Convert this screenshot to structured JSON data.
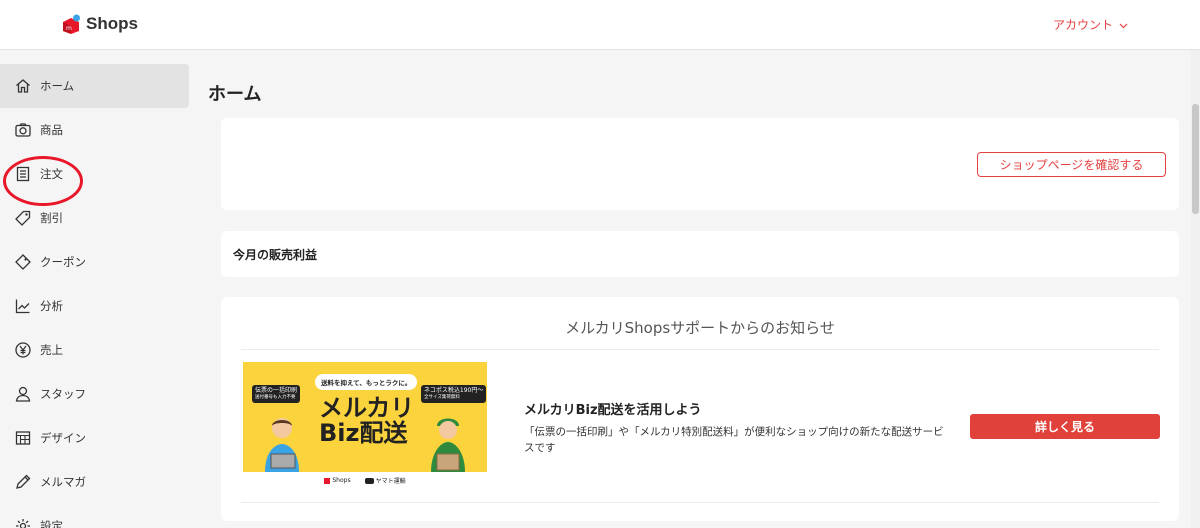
{
  "header": {
    "logo_text": "Shops",
    "account_label": "アカウント"
  },
  "sidebar": {
    "items": [
      {
        "label": "ホーム",
        "icon": "home-icon",
        "active": true
      },
      {
        "label": "商品",
        "icon": "camera-icon"
      },
      {
        "label": "注文",
        "icon": "list-icon"
      },
      {
        "label": "割引",
        "icon": "tag-icon"
      },
      {
        "label": "クーポン",
        "icon": "coupon-icon"
      },
      {
        "label": "分析",
        "icon": "chart-icon"
      },
      {
        "label": "売上",
        "icon": "yen-icon"
      },
      {
        "label": "スタッフ",
        "icon": "user-icon"
      },
      {
        "label": "デザイン",
        "icon": "design-icon"
      },
      {
        "label": "メルマガ",
        "icon": "pen-icon"
      },
      {
        "label": "設定",
        "icon": "gear-icon"
      }
    ]
  },
  "main": {
    "title": "ホーム",
    "shop_page_button": "ショップページを確認する",
    "monthly_profit_label": "今月の販売利益",
    "notice": {
      "title": "メルカリShopsサポートからのお知らせ",
      "headline": "メルカリBiz配送を活用しよう",
      "description": "「伝票の一括印刷」や「メルカリ特別配送料」が便利なショップ向けの新たな配送サービスです",
      "detail_button": "詳しく見る",
      "banner": {
        "top_bubble": "送料を抑えて、もっとラクに。",
        "left_bubble": "伝票の一括印刷",
        "left_bubble_sub": "送付番号も入力不要",
        "right_bubble": "ネコポス税込190円〜",
        "right_bubble_sub": "全サイズ集荷無料",
        "main_line1": "メルカリ",
        "main_line2": "Biz配送",
        "footer_left": "Shops",
        "footer_right": "ヤマト運輸"
      }
    }
  },
  "colors": {
    "accent": "#e64040",
    "button": "#e0413a",
    "banner_bg": "#fbd33c",
    "highlight": "#e8182a"
  }
}
